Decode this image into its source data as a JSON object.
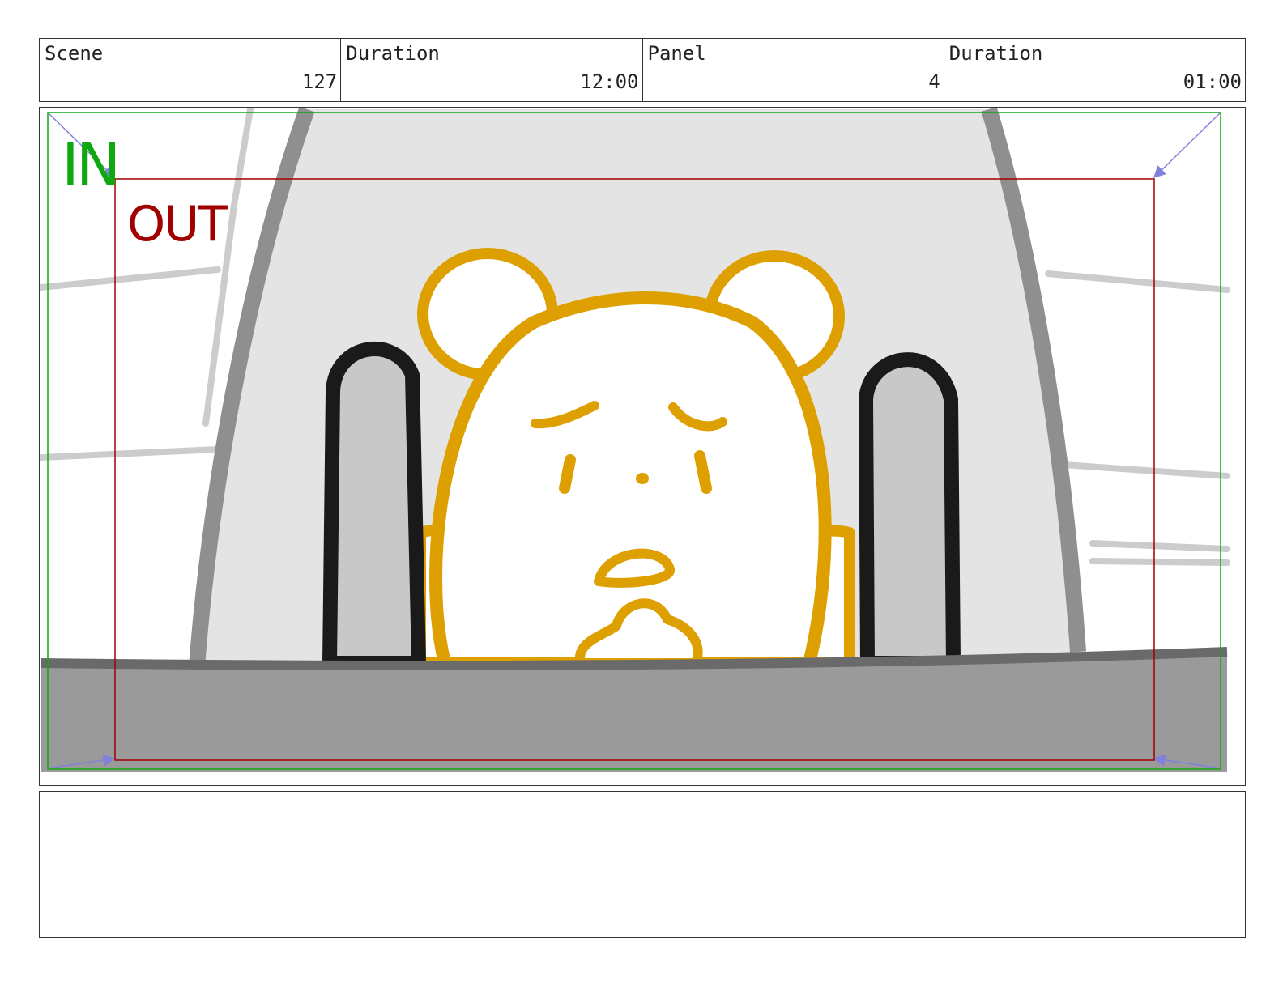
{
  "header": {
    "scene_label": "Scene",
    "scene_value": "127",
    "scene_duration_label": "Duration",
    "scene_duration_value": "12:00",
    "panel_label": "Panel",
    "panel_value": "4",
    "panel_duration_label": "Duration",
    "panel_duration_value": "01:00"
  },
  "frame": {
    "in_label": "IN",
    "out_label": "OUT",
    "in_color": "#10a810",
    "out_color": "#a00000"
  },
  "colors": {
    "bear_outline": "#dda000",
    "seat": "#e4e4e4",
    "seat_edge": "#8f8f8f",
    "dash": "#9a9a9a",
    "arrow": "#8080dd"
  },
  "notes": {
    "text": ""
  }
}
